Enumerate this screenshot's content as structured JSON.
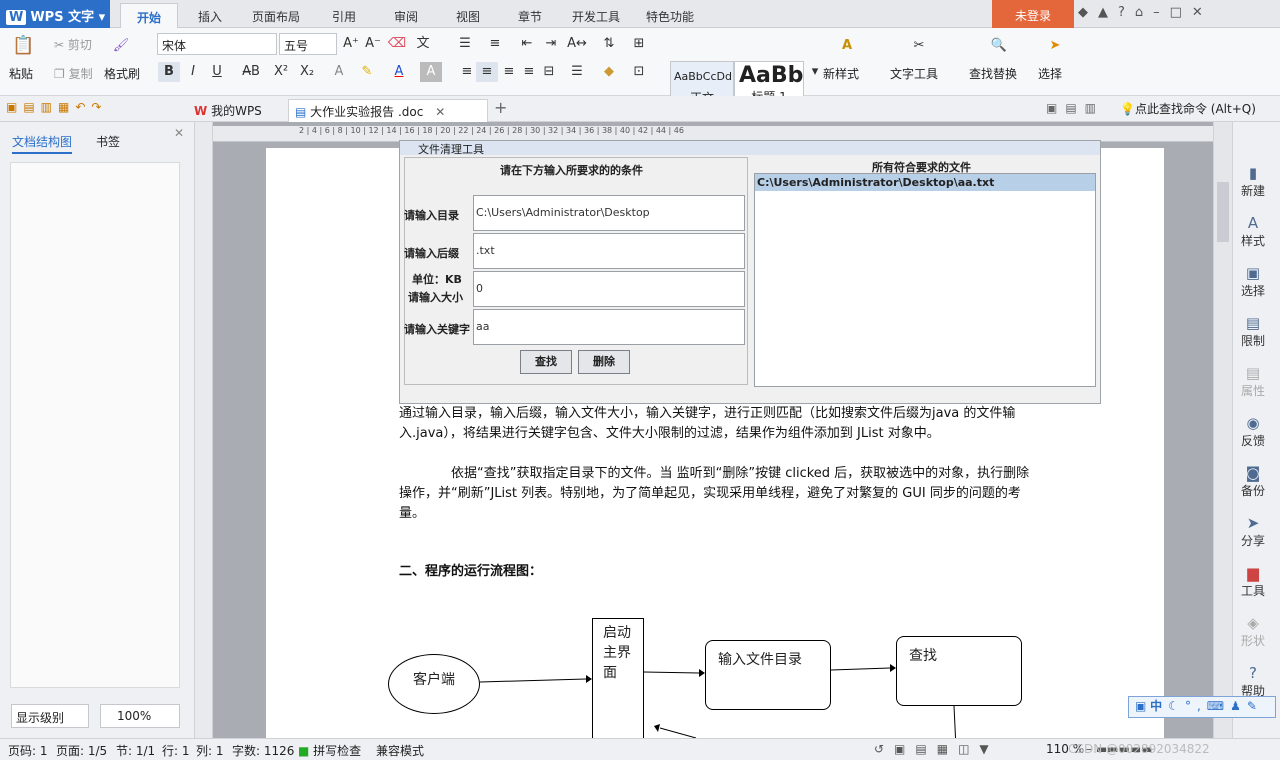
{
  "app": {
    "title": "WPS 文字",
    "login": "未登录"
  },
  "menu": [
    "开始",
    "插入",
    "页面布局",
    "引用",
    "审阅",
    "视图",
    "章节",
    "开发工具",
    "特色功能"
  ],
  "ribbon": {
    "paste": "粘贴",
    "cut": "剪切",
    "copy": "复制",
    "format_painter": "格式刷",
    "font_name": "宋体",
    "font_size": "五号",
    "style_normal_sample": "AaBbCcDd",
    "style_normal": "正文",
    "style_h1_sample": "AaBb",
    "style_h1": "标题 1",
    "new_style": "新样式",
    "text_tools": "文字工具",
    "find_replace": "查找替换",
    "select": "选择"
  },
  "tabs": {
    "home": "我的WPS",
    "doc": "大作业实验报告 .doc",
    "search_hint": "点此查找命令 (Alt+Q)"
  },
  "left_panel": {
    "tab1": "文档结构图",
    "tab2": "书签",
    "level": "显示级别",
    "zoom": "100%"
  },
  "ruler": {
    "h": "2 | 4 | 6 | 8 | 10 | 12 | 14 | 16 | 18 | 20 | 22 | 24 | 26 | 28 | 30 | 32 | 34 | 36 | 38 | 40 | 42 | 44 | 46"
  },
  "dialog": {
    "title": "文件清理工具",
    "left_heading": "请在下方输入所要求的的条件",
    "right_heading": "所有符合要求的文件",
    "dir_label": "请输入目录",
    "dir_value": "C:\\Users\\Administrator\\Desktop",
    "suffix_label": "请输入后缀",
    "suffix_value": ".txt",
    "unit_label": "单位：KB",
    "size_label": "请输入大小",
    "size_value": "0",
    "keyword_label": "请输入关键字",
    "keyword_value": "aa",
    "find": "查找",
    "delete": "删除",
    "result": "C:\\Users\\Administrator\\Desktop\\aa.txt"
  },
  "doc": {
    "p1": "通过输入目录，输入后缀，输入文件大小，输入关键字，进行正则匹配（比如搜索文件后缀为java 的文件输入.java），将结果进行关键字包含、文件大小限制的过滤，结果作为组件添加到 JList 对象中。",
    "p2": "依据“查找”获取指定目录下的文件。当 监听到“删除”按键 clicked 后，获取被选中的对象，执行删除操作，并“刷新”JList 列表。特别地，为了简单起见，实现采用单线程，避免了对繁复的 GUI 同步的问题的考量。",
    "heading": "二、程序的运行流程图：",
    "flow": {
      "client": "客户端",
      "start": "启动主界面",
      "input_dir": "输入文件目录",
      "find": "查找"
    }
  },
  "right_bar": [
    "新建",
    "样式",
    "选择",
    "限制",
    "属性",
    "反馈",
    "备份",
    "分享",
    "工具",
    "形状",
    "帮助"
  ],
  "status": {
    "page": "页码: 1",
    "pages": "页面: 1/5",
    "section": "节: 1/1",
    "row": "行: 1",
    "col": "列: 1",
    "words": "字数: 1126",
    "spell": "拼写检查",
    "compat": "兼容模式",
    "zoom": "110 %",
    "watermark": "CSDN @002892034822"
  },
  "ime": {
    "lang": "中"
  }
}
